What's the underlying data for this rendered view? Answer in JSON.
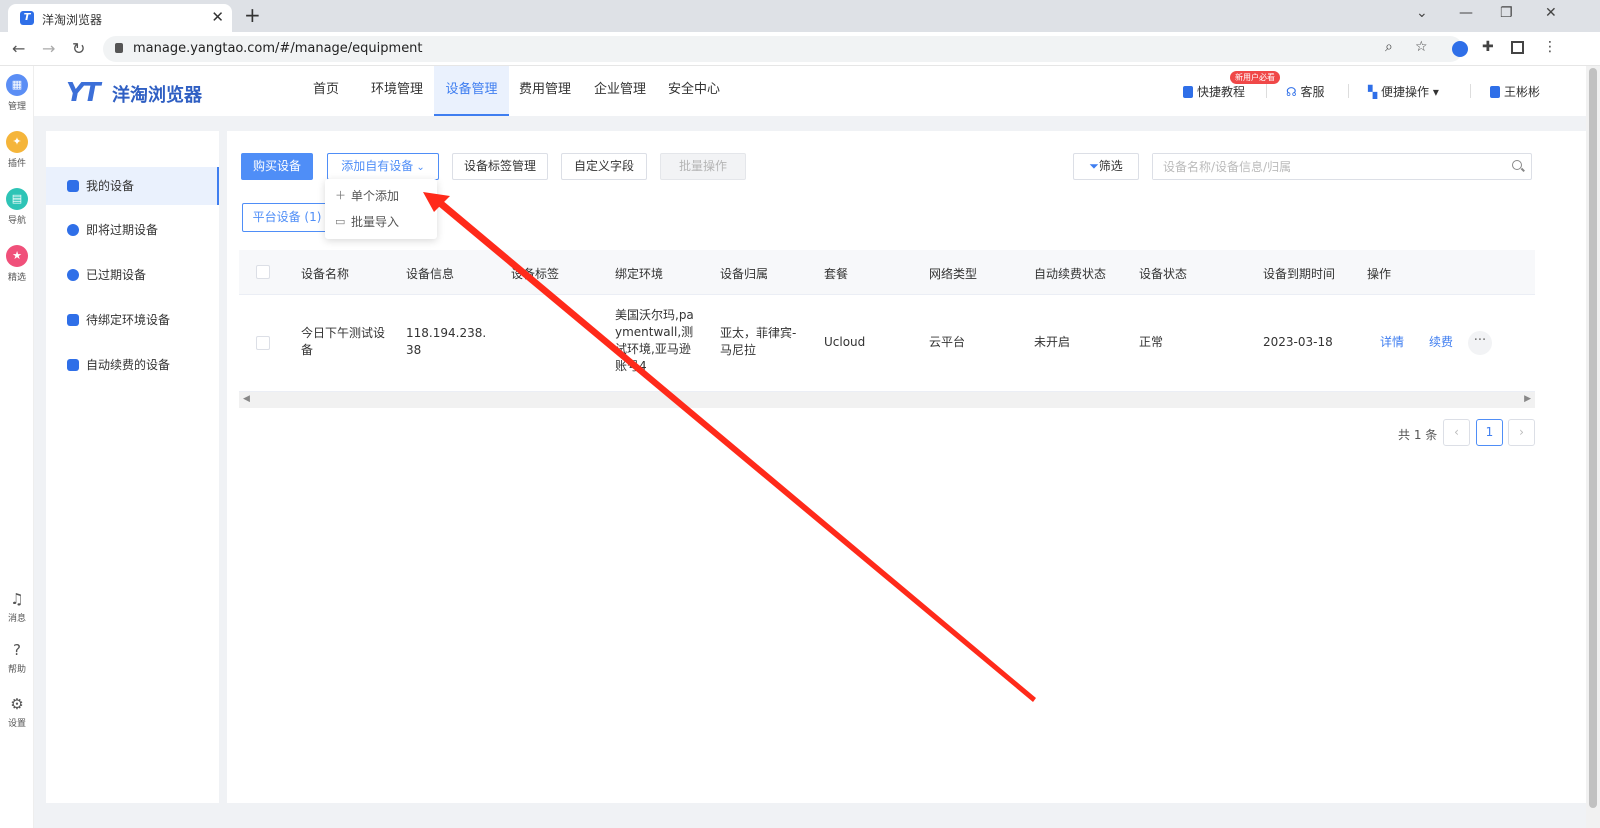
{
  "browser": {
    "tab_title": "洋淘浏览器",
    "tab_close": "✕",
    "new_tab": "+",
    "url": "manage.yangtao.com/#/manage/equipment"
  },
  "rail": {
    "items": [
      {
        "label": "管理",
        "color": "#5b8ef5"
      },
      {
        "label": "插件",
        "color": "#f5b53a"
      },
      {
        "label": "导航",
        "color": "#2ec4b6"
      },
      {
        "label": "精选",
        "color": "#f0507a"
      }
    ],
    "bottom": [
      {
        "label": "消息",
        "icon": "bell-icon"
      },
      {
        "label": "帮助",
        "icon": "help-icon"
      },
      {
        "label": "设置",
        "icon": "settings-icon"
      }
    ]
  },
  "header": {
    "logo_mark": "YT",
    "logo_text": "洋淘浏览器",
    "nav": [
      "首页",
      "环境管理",
      "设备管理",
      "费用管理",
      "企业管理",
      "安全中心"
    ],
    "active_nav": "设备管理",
    "tutorial": "快捷教程",
    "tutorial_badge": "新用户必看",
    "service": "客服",
    "quick_ops": "便捷操作",
    "user": "王彬彬"
  },
  "sidemenu": {
    "items": [
      "我的设备",
      "即将过期设备",
      "已过期设备",
      "待绑定环境设备",
      "自动续费的设备"
    ],
    "active": "我的设备"
  },
  "toolbar": {
    "buy": "购买设备",
    "add_own": "添加自有设备",
    "tag_manage": "设备标签管理",
    "custom_fields": "自定义字段",
    "batch_ops": "批量操作",
    "filter": "筛选",
    "search_placeholder": "设备名称/设备信息/归属"
  },
  "dropdown": {
    "items": [
      "单个添加",
      "批量导入"
    ]
  },
  "platform_tab": "平台设备 (1)",
  "table": {
    "headers": [
      "设备名称",
      "设备信息",
      "设备标签",
      "绑定环境",
      "设备归属",
      "套餐",
      "网络类型",
      "自动续费状态",
      "设备状态",
      "设备到期时间",
      "操作"
    ],
    "rows": [
      {
        "name": "今日下午测试设备",
        "info": "118.194.238.38",
        "tag": "",
        "env": "美国沃尔玛,paymentwall,测试环境,亚马逊账号4",
        "owner": "亚太，菲律宾-马尼拉",
        "plan": "Ucloud",
        "network": "云平台",
        "auto_renew": "未开启",
        "status": "正常",
        "expire": "2023-03-18",
        "action_detail": "详情",
        "action_renew": "续费",
        "action_more": "···"
      }
    ]
  },
  "pager": {
    "total": "共 1 条",
    "current": "1",
    "prev": "‹",
    "next": "›"
  },
  "colors": {
    "accent": "#4f8ef7",
    "annotation_arrow": "#ff2a1a"
  }
}
